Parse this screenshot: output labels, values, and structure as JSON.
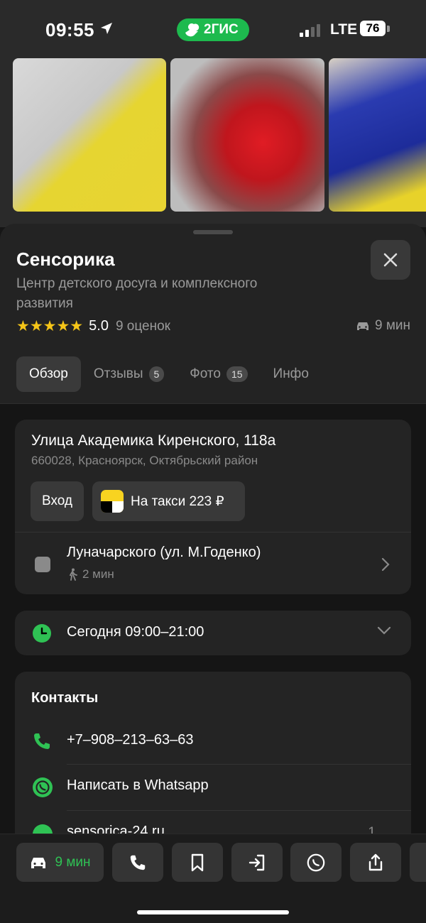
{
  "status_bar": {
    "time": "09:55",
    "brand": "2ГИС",
    "network": "LTE",
    "battery": "76"
  },
  "place": {
    "title": "Сенсорика",
    "subtitle": "Центр детского досуга и комплексного развития",
    "stars": "★★★★★",
    "rating": "5.0",
    "reviews": "9 оценок",
    "drive_time": "9 мин"
  },
  "tabs": [
    {
      "label": "Обзор"
    },
    {
      "label": "Отзывы",
      "badge": "5"
    },
    {
      "label": "Фото",
      "badge": "15"
    },
    {
      "label": "Инфо"
    }
  ],
  "address": {
    "main": "Улица Академика Киренского, 118а",
    "sub": "660028, Красноярск, Октябрьский район",
    "entry_label": "Вход",
    "taxi_label": "На такси 223 ₽"
  },
  "transit": {
    "stop": "Луначарского (ул. М.Годенко)",
    "walk": "2 мин"
  },
  "hours": {
    "text": "Сегодня 09:00–21:00"
  },
  "contacts": {
    "title": "Контакты",
    "phone": "+7‒908‒213‒63‒63",
    "whatsapp": "Написать в Whatsapp",
    "website": "sensorica-24.ru",
    "website_count": "1"
  },
  "bottom_bar": {
    "drive_label": "9 мин"
  },
  "colors": {
    "accent_green": "#1dba4e",
    "star": "#f5c518",
    "sheet": "#232323",
    "card": "#242424"
  }
}
